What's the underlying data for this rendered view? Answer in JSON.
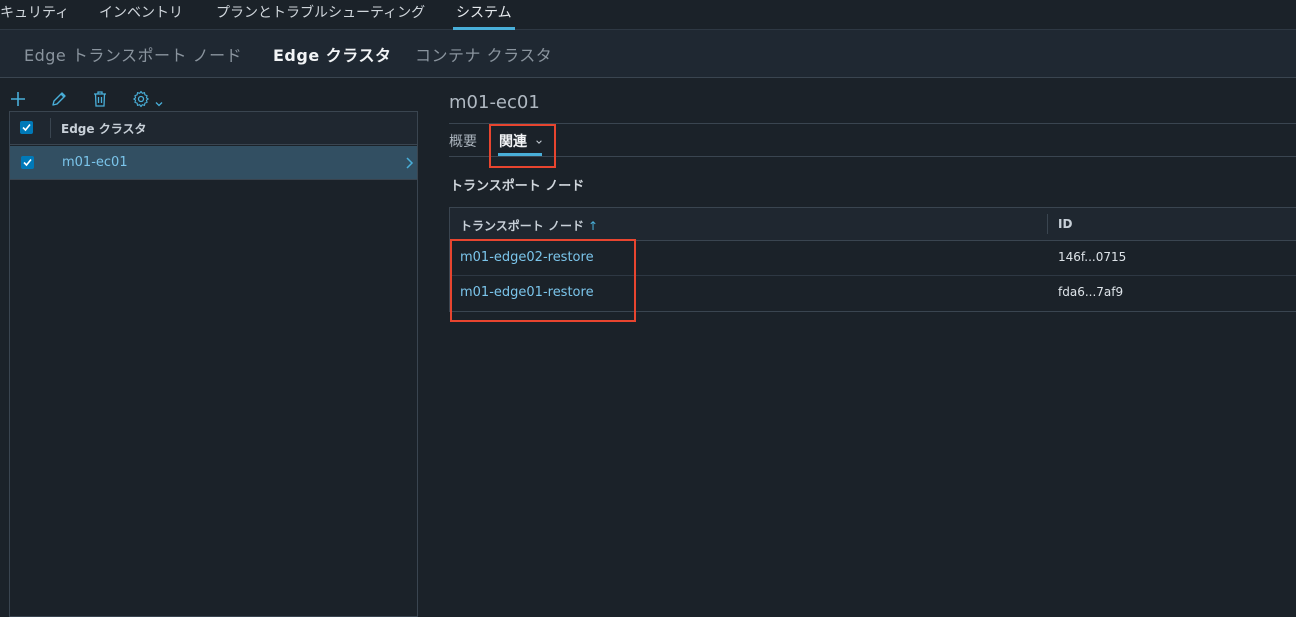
{
  "top_nav": {
    "items": [
      "キュリティ",
      "インベントリ",
      "プランとトラブルシューティング",
      "システム"
    ],
    "active_index": 3
  },
  "sub_nav": {
    "tabs": [
      "Edge トランスポート ノード",
      "Edge クラスタ",
      "コンテナ クラスタ"
    ],
    "active_index": 1
  },
  "toolbar": {
    "icons": [
      "plus-icon",
      "pencil-icon",
      "trash-icon",
      "gear-icon",
      "chevron-down-icon"
    ]
  },
  "list": {
    "header": "Edge クラスタ",
    "rows": [
      {
        "name": "m01-ec01",
        "checked": true
      }
    ]
  },
  "detail": {
    "title": "m01-ec01",
    "tabs": [
      "概要",
      "関連"
    ],
    "active_tab": 1,
    "section_title": "トランスポート ノード",
    "table": {
      "columns": [
        "トランスポート ノード",
        "ID"
      ],
      "sort_indicator": "↑",
      "rows": [
        {
          "node": "m01-edge02-restore",
          "id": "146f...0715"
        },
        {
          "node": "m01-edge01-restore",
          "id": "fda6...7af9"
        }
      ]
    }
  },
  "colors": {
    "accent": "#49afd9",
    "link": "#7bc5eb",
    "highlight_box": "#e8452f",
    "selected_row": "#324f62"
  }
}
